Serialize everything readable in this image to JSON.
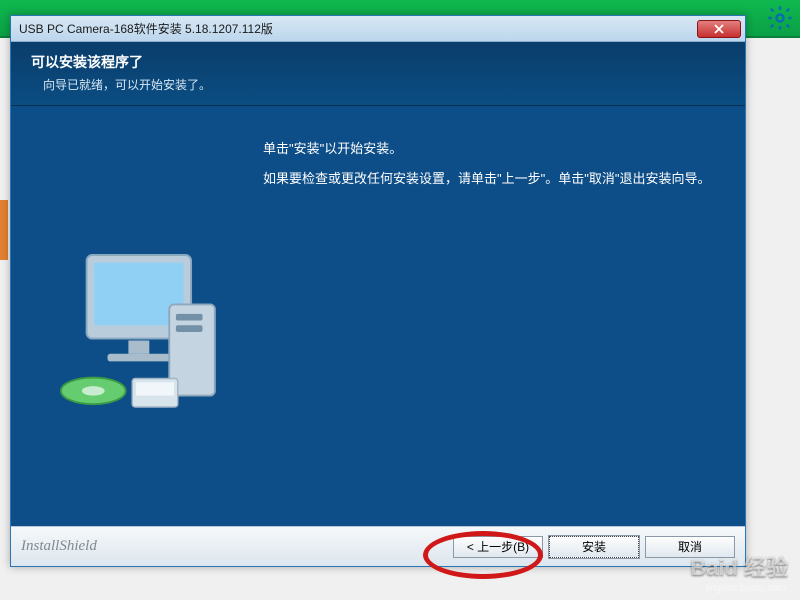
{
  "titlebar": {
    "title": "USB PC Camera-168软件安装 5.18.1207.112版"
  },
  "header": {
    "title": "可以安装该程序了",
    "sub": "向导已就绪，可以开始安装了。"
  },
  "content": {
    "line1": "单击\"安装\"以开始安装。",
    "line2": "如果要检查或更改任何安装设置，请单击\"上一步\"。单击\"取消\"退出安装向导。"
  },
  "footer": {
    "brand": "InstallShield",
    "back": "< 上一步(B)",
    "install": "安装",
    "cancel": "取消"
  },
  "watermark": {
    "main": "Baid 经验",
    "sub": "jingyan.baidu.com"
  }
}
